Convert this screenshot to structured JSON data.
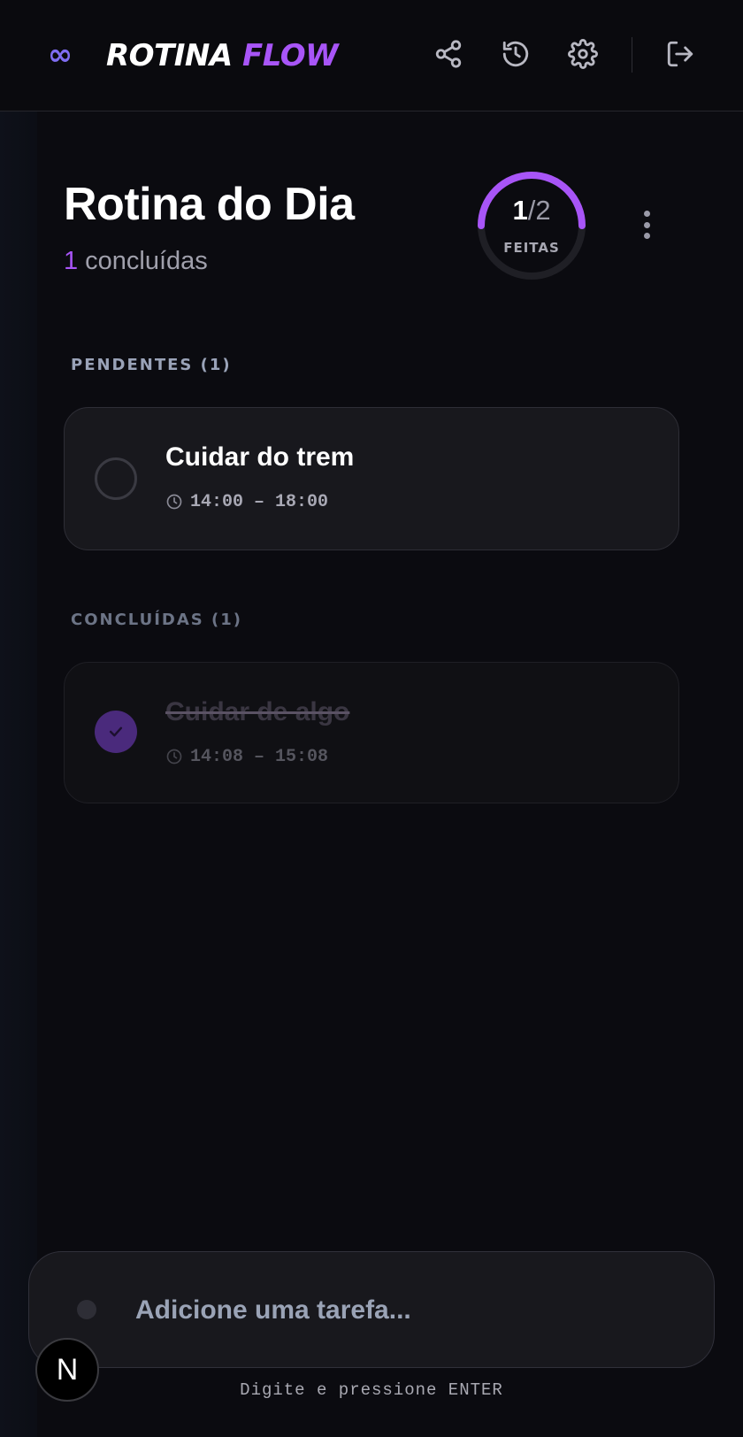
{
  "app": {
    "logo_symbol": "∞",
    "title_part1": "ROTINA",
    "title_part2": "FLOW"
  },
  "header_icons": [
    "share-icon",
    "history-icon",
    "settings-icon",
    "logout-icon"
  ],
  "page": {
    "title": "Rotina do Dia",
    "done_count": "1",
    "done_label": "concluídas"
  },
  "progress": {
    "done": "1",
    "separator": "/",
    "total": "2",
    "label": "FEITAS",
    "fraction": 0.5,
    "color": "#a855f7"
  },
  "sections": {
    "pending_label": "PENDENTES (1)",
    "done_label": "CONCLUÍDAS (1)"
  },
  "tasks": {
    "pending": [
      {
        "title": "Cuidar do trem",
        "time": "14:00 – 18:00"
      }
    ],
    "done": [
      {
        "title": "Cuidar de algo",
        "time": "14:08 – 15:08"
      }
    ]
  },
  "add_task": {
    "placeholder": "Adicione uma tarefa...",
    "value": "",
    "hint": "Digite e pressione ENTER"
  },
  "badge": {
    "letter": "N"
  },
  "colors": {
    "accent": "#a855f7",
    "background": "#0b0b10",
    "card": "#18181d"
  }
}
